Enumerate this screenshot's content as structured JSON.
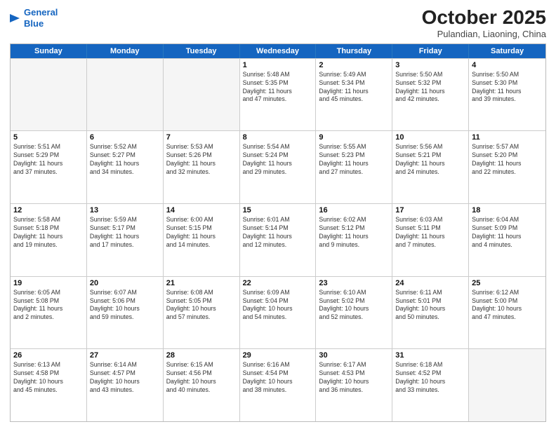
{
  "header": {
    "logo_line1": "General",
    "logo_line2": "Blue",
    "month": "October 2025",
    "location": "Pulandian, Liaoning, China"
  },
  "days_of_week": [
    "Sunday",
    "Monday",
    "Tuesday",
    "Wednesday",
    "Thursday",
    "Friday",
    "Saturday"
  ],
  "weeks": [
    [
      {
        "day": "",
        "info": ""
      },
      {
        "day": "",
        "info": ""
      },
      {
        "day": "",
        "info": ""
      },
      {
        "day": "1",
        "info": "Sunrise: 5:48 AM\nSunset: 5:35 PM\nDaylight: 11 hours\nand 47 minutes."
      },
      {
        "day": "2",
        "info": "Sunrise: 5:49 AM\nSunset: 5:34 PM\nDaylight: 11 hours\nand 45 minutes."
      },
      {
        "day": "3",
        "info": "Sunrise: 5:50 AM\nSunset: 5:32 PM\nDaylight: 11 hours\nand 42 minutes."
      },
      {
        "day": "4",
        "info": "Sunrise: 5:50 AM\nSunset: 5:30 PM\nDaylight: 11 hours\nand 39 minutes."
      }
    ],
    [
      {
        "day": "5",
        "info": "Sunrise: 5:51 AM\nSunset: 5:29 PM\nDaylight: 11 hours\nand 37 minutes."
      },
      {
        "day": "6",
        "info": "Sunrise: 5:52 AM\nSunset: 5:27 PM\nDaylight: 11 hours\nand 34 minutes."
      },
      {
        "day": "7",
        "info": "Sunrise: 5:53 AM\nSunset: 5:26 PM\nDaylight: 11 hours\nand 32 minutes."
      },
      {
        "day": "8",
        "info": "Sunrise: 5:54 AM\nSunset: 5:24 PM\nDaylight: 11 hours\nand 29 minutes."
      },
      {
        "day": "9",
        "info": "Sunrise: 5:55 AM\nSunset: 5:23 PM\nDaylight: 11 hours\nand 27 minutes."
      },
      {
        "day": "10",
        "info": "Sunrise: 5:56 AM\nSunset: 5:21 PM\nDaylight: 11 hours\nand 24 minutes."
      },
      {
        "day": "11",
        "info": "Sunrise: 5:57 AM\nSunset: 5:20 PM\nDaylight: 11 hours\nand 22 minutes."
      }
    ],
    [
      {
        "day": "12",
        "info": "Sunrise: 5:58 AM\nSunset: 5:18 PM\nDaylight: 11 hours\nand 19 minutes."
      },
      {
        "day": "13",
        "info": "Sunrise: 5:59 AM\nSunset: 5:17 PM\nDaylight: 11 hours\nand 17 minutes."
      },
      {
        "day": "14",
        "info": "Sunrise: 6:00 AM\nSunset: 5:15 PM\nDaylight: 11 hours\nand 14 minutes."
      },
      {
        "day": "15",
        "info": "Sunrise: 6:01 AM\nSunset: 5:14 PM\nDaylight: 11 hours\nand 12 minutes."
      },
      {
        "day": "16",
        "info": "Sunrise: 6:02 AM\nSunset: 5:12 PM\nDaylight: 11 hours\nand 9 minutes."
      },
      {
        "day": "17",
        "info": "Sunrise: 6:03 AM\nSunset: 5:11 PM\nDaylight: 11 hours\nand 7 minutes."
      },
      {
        "day": "18",
        "info": "Sunrise: 6:04 AM\nSunset: 5:09 PM\nDaylight: 11 hours\nand 4 minutes."
      }
    ],
    [
      {
        "day": "19",
        "info": "Sunrise: 6:05 AM\nSunset: 5:08 PM\nDaylight: 11 hours\nand 2 minutes."
      },
      {
        "day": "20",
        "info": "Sunrise: 6:07 AM\nSunset: 5:06 PM\nDaylight: 10 hours\nand 59 minutes."
      },
      {
        "day": "21",
        "info": "Sunrise: 6:08 AM\nSunset: 5:05 PM\nDaylight: 10 hours\nand 57 minutes."
      },
      {
        "day": "22",
        "info": "Sunrise: 6:09 AM\nSunset: 5:04 PM\nDaylight: 10 hours\nand 54 minutes."
      },
      {
        "day": "23",
        "info": "Sunrise: 6:10 AM\nSunset: 5:02 PM\nDaylight: 10 hours\nand 52 minutes."
      },
      {
        "day": "24",
        "info": "Sunrise: 6:11 AM\nSunset: 5:01 PM\nDaylight: 10 hours\nand 50 minutes."
      },
      {
        "day": "25",
        "info": "Sunrise: 6:12 AM\nSunset: 5:00 PM\nDaylight: 10 hours\nand 47 minutes."
      }
    ],
    [
      {
        "day": "26",
        "info": "Sunrise: 6:13 AM\nSunset: 4:58 PM\nDaylight: 10 hours\nand 45 minutes."
      },
      {
        "day": "27",
        "info": "Sunrise: 6:14 AM\nSunset: 4:57 PM\nDaylight: 10 hours\nand 43 minutes."
      },
      {
        "day": "28",
        "info": "Sunrise: 6:15 AM\nSunset: 4:56 PM\nDaylight: 10 hours\nand 40 minutes."
      },
      {
        "day": "29",
        "info": "Sunrise: 6:16 AM\nSunset: 4:54 PM\nDaylight: 10 hours\nand 38 minutes."
      },
      {
        "day": "30",
        "info": "Sunrise: 6:17 AM\nSunset: 4:53 PM\nDaylight: 10 hours\nand 36 minutes."
      },
      {
        "day": "31",
        "info": "Sunrise: 6:18 AM\nSunset: 4:52 PM\nDaylight: 10 hours\nand 33 minutes."
      },
      {
        "day": "",
        "info": ""
      }
    ]
  ]
}
